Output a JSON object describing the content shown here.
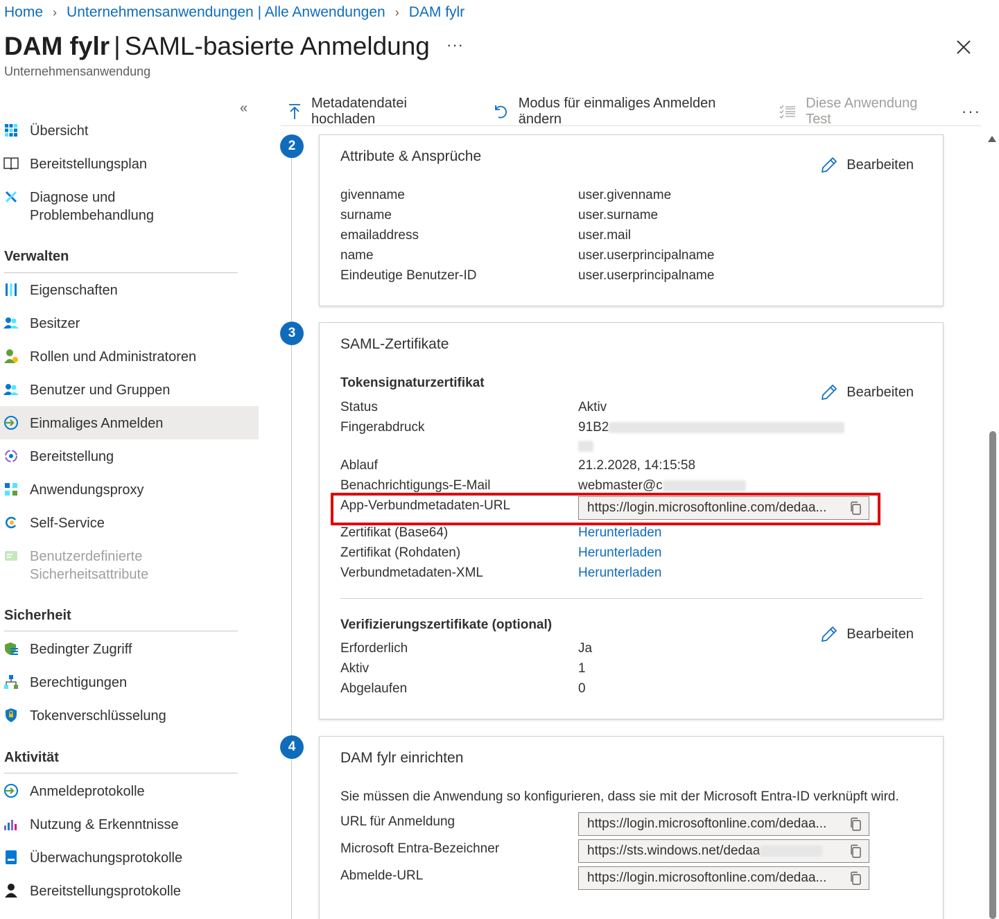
{
  "breadcrumb": [
    "Home",
    "Unternehmensanwendungen | Alle Anwendungen",
    "DAM fylr"
  ],
  "header": {
    "title_bold": "DAM fylr",
    "title_rest": "SAML-basierte Anmeldung",
    "subtitle": "Unternehmensanwendung",
    "more": "···"
  },
  "sidebar": {
    "collapse": "«",
    "items": [
      {
        "label": "Übersicht"
      },
      {
        "label": "Bereitstellungsplan"
      },
      {
        "label_line1": "Diagnose und",
        "label_line2": "Problembehandlung"
      }
    ],
    "sections": [
      "Verwalten",
      "Sicherheit",
      "Aktivität"
    ],
    "manage": [
      {
        "label": "Eigenschaften"
      },
      {
        "label": "Besitzer"
      },
      {
        "label": "Rollen und Administratoren"
      },
      {
        "label": "Benutzer und Gruppen"
      },
      {
        "label": "Einmaliges Anmelden"
      },
      {
        "label": "Bereitstellung"
      },
      {
        "label": "Anwendungsproxy"
      },
      {
        "label": "Self-Service"
      },
      {
        "label_line1": "Benutzerdefinierte",
        "label_line2": "Sicherheitsattribute"
      }
    ],
    "security": [
      {
        "label": "Bedingter Zugriff"
      },
      {
        "label": "Berechtigungen"
      },
      {
        "label": "Tokenverschlüsselung"
      }
    ],
    "activity": [
      {
        "label": "Anmeldeprotokolle"
      },
      {
        "label": "Nutzung & Erkenntnisse"
      },
      {
        "label": "Überwachungsprotokolle"
      },
      {
        "label": "Bereitstellungsprotokolle"
      }
    ]
  },
  "toolbar": {
    "upload": "Metadatendatei hochladen",
    "change_mode": "Modus für einmaliges Anmelden ändern",
    "test": "Diese Anwendung Test",
    "more": "···"
  },
  "steps": [
    "2",
    "3",
    "4"
  ],
  "attributes": {
    "title": "Attribute & Ansprüche",
    "edit": "Bearbeiten",
    "rows": [
      {
        "name": "givenname",
        "value": "user.givenname"
      },
      {
        "name": "surname",
        "value": "user.surname"
      },
      {
        "name": "emailaddress",
        "value": "user.mail"
      },
      {
        "name": "name",
        "value": "user.userprincipalname"
      },
      {
        "name": "Eindeutige Benutzer-ID",
        "value": "user.userprincipalname"
      }
    ]
  },
  "saml": {
    "title": "SAML-Zertifikate",
    "token_title": "Tokensignaturzertifikat",
    "edit": "Bearbeiten",
    "status_label": "Status",
    "status_value": "Aktiv",
    "fingerprint_label": "Fingerabdruck",
    "fingerprint_value": "91B2",
    "expiry_label": "Ablauf",
    "expiry_value": "21.2.2028, 14:15:58",
    "email_label": "Benachrichtigungs-E-Mail",
    "email_value": "webmaster@c",
    "metadata_url_label": "App-Verbundmetadaten-URL",
    "metadata_url_value": "https://login.microsoftonline.com/dedaa...",
    "cert_base64_label": "Zertifikat (Base64)",
    "cert_raw_label": "Zertifikat (Rohdaten)",
    "federation_xml_label": "Verbundmetadaten-XML",
    "download": "Herunterladen",
    "verify_title": "Verifizierungszertifikate (optional)",
    "verify_edit": "Bearbeiten",
    "required_label": "Erforderlich",
    "required_value": "Ja",
    "active_label": "Aktiv",
    "active_value": "1",
    "expired_label": "Abgelaufen",
    "expired_value": "0"
  },
  "setup": {
    "title": "DAM fylr einrichten",
    "description": "Sie müssen die Anwendung so konfigurieren, dass sie mit der Microsoft Entra-ID verknüpft wird.",
    "login_url_label": "URL für Anmeldung",
    "login_url_value": "https://login.microsoftonline.com/dedaa...",
    "entra_id_label": "Microsoft Entra-Bezeichner",
    "entra_id_value": "https://sts.windows.net/dedaa",
    "logout_url_label": "Abmelde-URL",
    "logout_url_value": "https://login.microsoftonline.com/dedaa..."
  },
  "colors": {
    "accent": "#0f6cbd",
    "highlight": "#e00000"
  }
}
